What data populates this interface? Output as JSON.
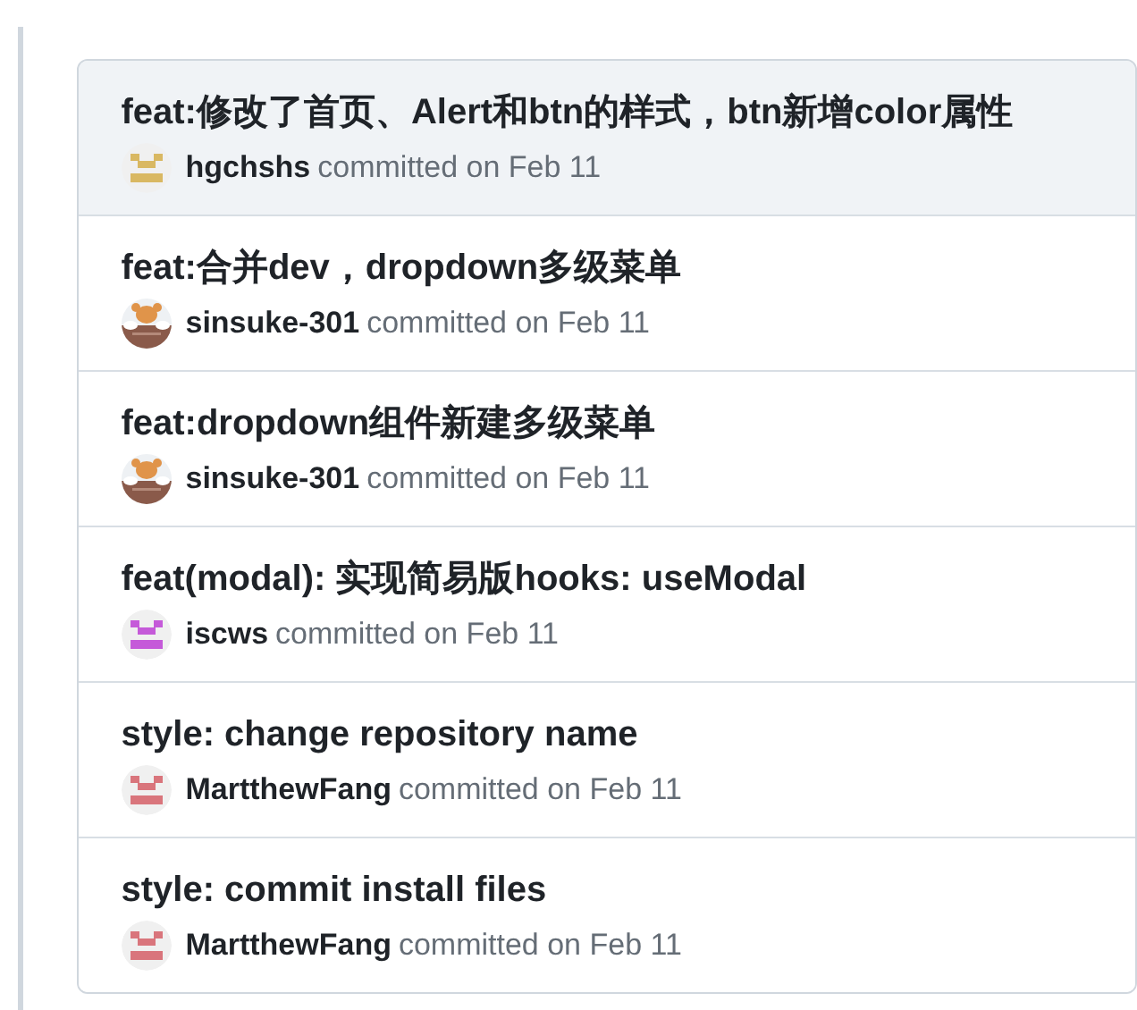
{
  "commits": [
    {
      "title": "feat:修改了首页、Alert和btn的样式，btn新增color属性",
      "author": "hgchshs",
      "meta": "committed on Feb 11",
      "selected": true,
      "avatar": {
        "kind": "identicon",
        "color": "#d9b862"
      }
    },
    {
      "title": "feat:合并dev，dropdown多级菜单",
      "author": "sinsuke-301",
      "meta": "committed on Feb 11",
      "selected": false
    },
    {
      "title": "feat:dropdown组件新建多级菜单",
      "author": "sinsuke-301",
      "meta": "committed on Feb 11",
      "selected": false
    },
    {
      "title": "feat(modal): 实现简易版hooks: useModal",
      "author": "iscws",
      "meta": "committed on Feb 11",
      "selected": false,
      "avatar": {
        "kind": "identicon",
        "color": "#c55ad9"
      }
    },
    {
      "title": "style: change repository name",
      "author": "MartthewFang",
      "meta": "committed on Feb 11",
      "selected": false,
      "avatar": {
        "kind": "identicon",
        "color": "#d9757c"
      }
    },
    {
      "title": "style: commit install files",
      "author": "MartthewFang",
      "meta": "committed on Feb 11",
      "selected": false,
      "avatar": {
        "kind": "identicon",
        "color": "#d9757c"
      }
    }
  ]
}
